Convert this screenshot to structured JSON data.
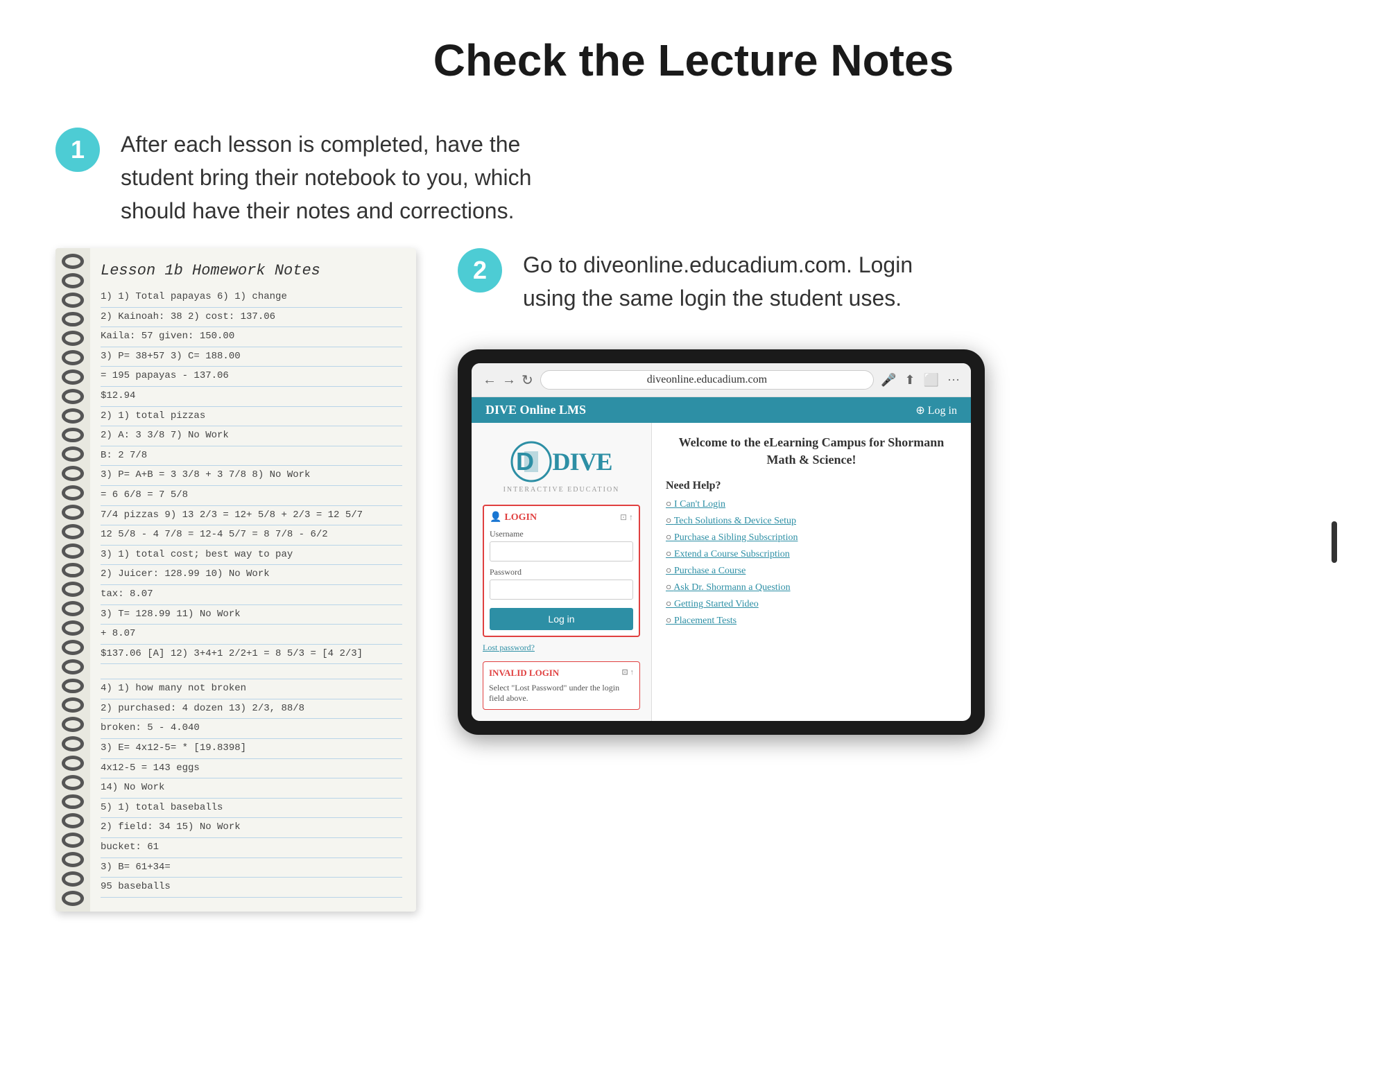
{
  "page": {
    "title": "Check the Lecture Notes",
    "background": "#ffffff"
  },
  "step1": {
    "badge": "1",
    "text": "After each lesson is completed, have the student bring their notebook to you, which should have their notes and corrections."
  },
  "step2": {
    "badge": "2",
    "text": "Go to diveonline.educadium.com. Login using the same login the student uses."
  },
  "notebook": {
    "title": "Lesson 1b Homework Notes",
    "lines": [
      "1) 1) Total papayas               6) 1) change",
      "   2) Kainoah: 38                    2) cost: 137.06",
      "      Kaila: 57                         given: 150.00",
      "   3) P= 38+57                       3) C= 188.00",
      "      = 195 papayas                      - 137.06",
      "                                         $12.94",
      "2) 1) total pizzas",
      "   2) A: 3 3/8           7) No Work",
      "      B: 2 7/8",
      "   3) P= A+B = 3 3/8 + 3 7/8    8) No Work",
      "      = 6 6/8 = 7 5/8",
      "      7/4 pizzas        9) 13 2/3 = 12+ 5/8 + 2/3 = 12 5/7",
      "                           12 5/8 - 4 7/8 = 12-4 5/7 = 8 7/8 - 6/2",
      "3) 1) total cost; best way to pay",
      "   2) Juicer: 128.99     10) No Work",
      "      tax: 8.07",
      "   3) T= 128.99          11) No Work",
      "      + 8.07",
      "      $137.06 [A]    12) 3+4+1 2/2+1 = 8 5/3 = [4 2/3]",
      "",
      "4) 1) how many not broken",
      "   2) purchased: 4 dozen  13) 2/3, 88/8",
      "      broken: 5               - 4.040",
      "   3) E= 4x12-5=          * [19.8398]",
      "      4x12-5 = 143 eggs",
      "                      14) No Work",
      "5) 1) total baseballs",
      "   2) field: 34          15) No Work",
      "      bucket: 61",
      "   3) B= 61+34=",
      "      95 baseballs"
    ]
  },
  "browser": {
    "address": "diveonline.educadium.com",
    "back_icon": "←",
    "forward_icon": "→",
    "refresh_icon": "↻"
  },
  "lms": {
    "topbar_title": "DIVE Online LMS",
    "login_link": "⊕ Log in",
    "logo_main": "DIVE",
    "logo_subtitle": "INTERACTIVE EDUCATION",
    "login_box_title": "LOGIN",
    "username_label": "Username",
    "password_label": "Password",
    "login_button": "Log in",
    "lost_password": "Lost password?",
    "invalid_login_title": "INVALID LOGIN",
    "invalid_login_text": "Select \"Lost Password\" under the login field above.",
    "welcome_text": "Welcome to the eLearning Campus for Shormann Math & Science!",
    "need_help": "Need Help?",
    "help_links": [
      "I Can't Login",
      "Tech Solutions & Device Setup",
      "Purchase a Sibling Subscription",
      "Extend a Course Subscription",
      "Purchase a Course",
      "Ask Dr. Shormann a Question",
      "Getting Started Video",
      "Placement Tests"
    ]
  }
}
